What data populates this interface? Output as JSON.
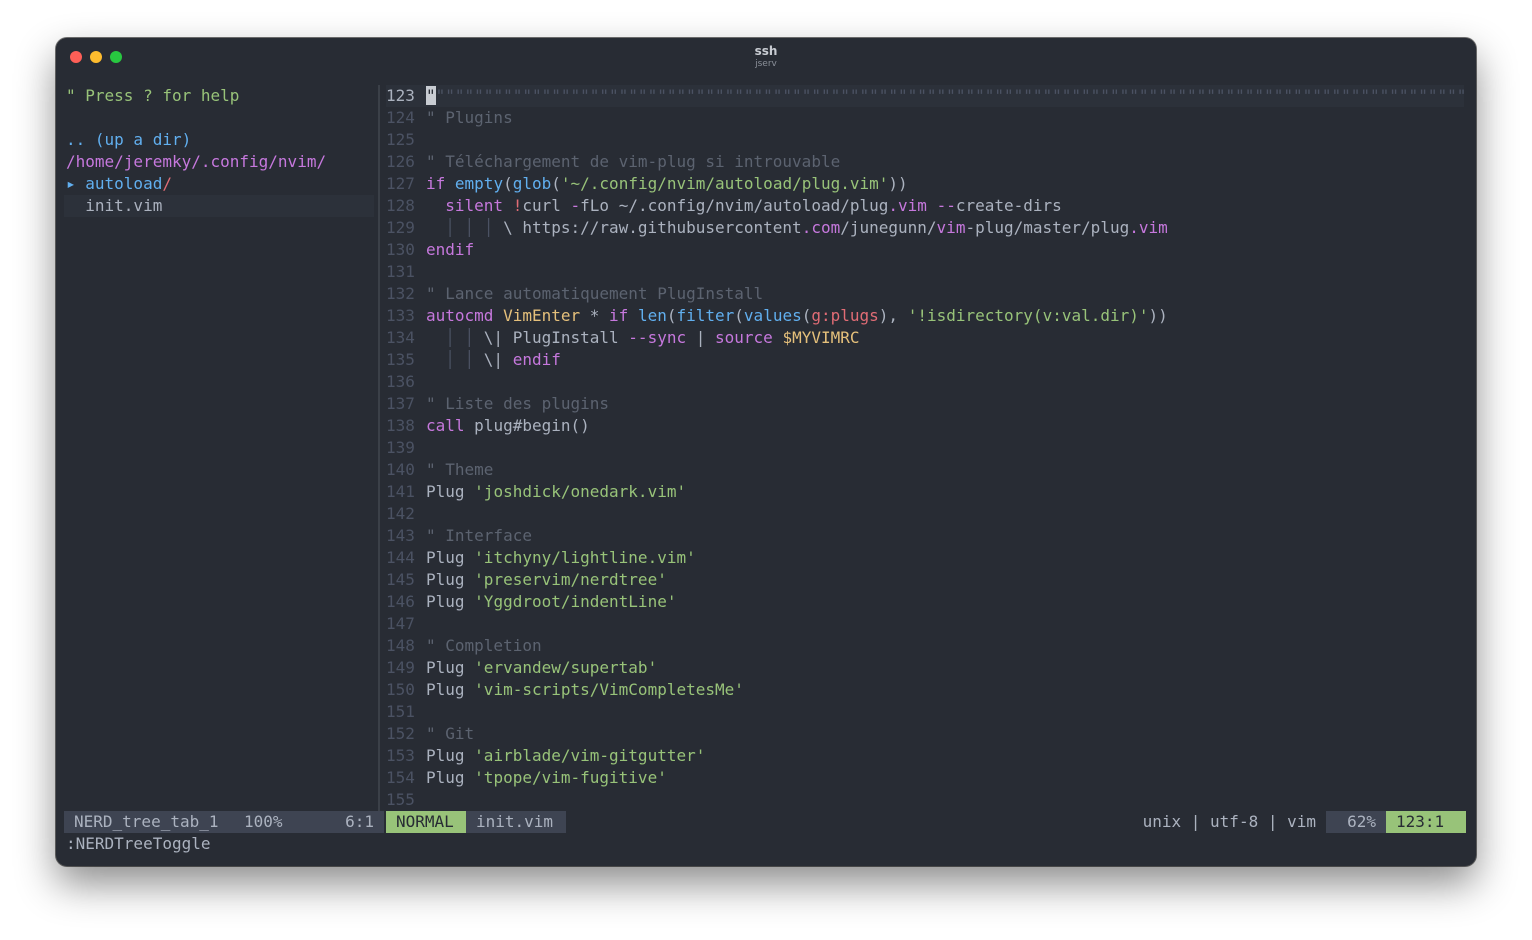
{
  "window": {
    "title": "ssh",
    "subtitle": "jserv"
  },
  "nerdtree": {
    "help": "\" Press ? for help",
    "up_dir": ".. (up a dir)",
    "root_path": "/home/jeremky/.config/nvim/",
    "dir_arrow": "▸ ",
    "dir_name": "autoload",
    "dir_slash": "/",
    "file_name": "init.vim"
  },
  "editor": {
    "lines": [
      {
        "n": "123",
        "tokens": [
          [
            "cursor",
            "\""
          ],
          [
            "c-dim",
            "\"\"\"\"\"\"\"\"\"\"\"\"\"\"\"\"\"\"\"\"\"\"\"\"\"\"\"\"\"\"\"\"\"\"\"\"\"\"\"\"\"\"\"\"\"\"\"\"\"\"\"\"\"\"\"\"\"\"\"\"\"\"\"\"\"\"\"\"\"\"\"\"\"\"\"\"\"\"\"\"\"\"\"\"\"\"\"\"\"\"\"\"\"\"\"\"\"\"\"\"\"\"\"\"\"\"\"\"\"\"\"\"\"\"\"\"\"\"\"\"\"\"\"\"\"\"\"\"\"\"\"\"\"\"\"\""
          ]
        ]
      },
      {
        "n": "124",
        "tokens": [
          [
            "c-cmt",
            "\" Plugins"
          ]
        ]
      },
      {
        "n": "125",
        "tokens": []
      },
      {
        "n": "126",
        "tokens": [
          [
            "c-cmt",
            "\" Téléchargement de vim-plug si introuvable"
          ]
        ]
      },
      {
        "n": "127",
        "tokens": [
          [
            "c-kw",
            "if "
          ],
          [
            "c-fn",
            "empty"
          ],
          [
            "c-pl",
            "("
          ],
          [
            "c-fn",
            "glob"
          ],
          [
            "c-pl",
            "("
          ],
          [
            "c-str",
            "'~/.config/nvim/autoload/plug.vim'"
          ],
          [
            "c-pl",
            "))"
          ]
        ]
      },
      {
        "n": "128",
        "tokens": [
          [
            "c-pl",
            "  "
          ],
          [
            "c-kw",
            "silent "
          ],
          [
            "c-red",
            "!"
          ],
          [
            "c-pl",
            "curl "
          ],
          [
            "c-kw",
            "-"
          ],
          [
            "c-pl",
            "fLo ~/.config/nvim/autoload/plug"
          ],
          [
            "c-kw",
            ".vim "
          ],
          [
            "c-kw",
            "--"
          ],
          [
            "c-pl",
            "create-dirs"
          ]
        ]
      },
      {
        "n": "129",
        "tokens": [
          [
            "c-dim",
            "  │ │ │ "
          ],
          [
            "c-pl",
            "\\ https://raw.githubusercontent"
          ],
          [
            "c-kw",
            ".com"
          ],
          [
            "c-pl",
            "/junegunn/"
          ],
          [
            "c-kw",
            "vim"
          ],
          [
            "c-pl",
            "-plug/master/plug"
          ],
          [
            "c-kw",
            ".vim"
          ]
        ]
      },
      {
        "n": "130",
        "tokens": [
          [
            "c-kw",
            "endif"
          ]
        ]
      },
      {
        "n": "131",
        "tokens": []
      },
      {
        "n": "132",
        "tokens": [
          [
            "c-cmt",
            "\" Lance automatiquement PlugInstall"
          ]
        ]
      },
      {
        "n": "133",
        "tokens": [
          [
            "c-kw",
            "autocmd "
          ],
          [
            "c-yel",
            "VimEnter "
          ],
          [
            "c-pl",
            "* "
          ],
          [
            "c-kw",
            "if "
          ],
          [
            "c-fn",
            "len"
          ],
          [
            "c-pl",
            "("
          ],
          [
            "c-fn",
            "filter"
          ],
          [
            "c-pl",
            "("
          ],
          [
            "c-fn",
            "values"
          ],
          [
            "c-pl",
            "("
          ],
          [
            "c-red",
            "g:plugs"
          ],
          [
            "c-pl",
            "), "
          ],
          [
            "c-str",
            "'!isdirectory(v:val.dir)'"
          ],
          [
            "c-pl",
            "))"
          ]
        ]
      },
      {
        "n": "134",
        "tokens": [
          [
            "c-dim",
            "  │ │ "
          ],
          [
            "c-pl",
            "\\| PlugInstall "
          ],
          [
            "c-kw",
            "--sync "
          ],
          [
            "c-pl",
            "| "
          ],
          [
            "c-kw",
            "source "
          ],
          [
            "c-yel",
            "$MYVIMRC"
          ]
        ]
      },
      {
        "n": "135",
        "tokens": [
          [
            "c-dim",
            "  │ │ "
          ],
          [
            "c-pl",
            "\\| "
          ],
          [
            "c-kw",
            "endif"
          ]
        ]
      },
      {
        "n": "136",
        "tokens": []
      },
      {
        "n": "137",
        "tokens": [
          [
            "c-cmt",
            "\" Liste des plugins"
          ]
        ]
      },
      {
        "n": "138",
        "tokens": [
          [
            "c-kw",
            "call "
          ],
          [
            "c-pl",
            "plug#begin()"
          ]
        ]
      },
      {
        "n": "139",
        "tokens": []
      },
      {
        "n": "140",
        "tokens": [
          [
            "c-cmt",
            "\" Theme"
          ]
        ]
      },
      {
        "n": "141",
        "tokens": [
          [
            "c-pl",
            "Plug "
          ],
          [
            "c-str",
            "'joshdick/onedark.vim'"
          ]
        ]
      },
      {
        "n": "142",
        "tokens": []
      },
      {
        "n": "143",
        "tokens": [
          [
            "c-cmt",
            "\" Interface"
          ]
        ]
      },
      {
        "n": "144",
        "tokens": [
          [
            "c-pl",
            "Plug "
          ],
          [
            "c-str",
            "'itchyny/lightline.vim'"
          ]
        ]
      },
      {
        "n": "145",
        "tokens": [
          [
            "c-pl",
            "Plug "
          ],
          [
            "c-str",
            "'preservim/nerdtree'"
          ]
        ]
      },
      {
        "n": "146",
        "tokens": [
          [
            "c-pl",
            "Plug "
          ],
          [
            "c-str",
            "'Yggdroot/indentLine'"
          ]
        ]
      },
      {
        "n": "147",
        "tokens": []
      },
      {
        "n": "148",
        "tokens": [
          [
            "c-cmt",
            "\" Completion"
          ]
        ]
      },
      {
        "n": "149",
        "tokens": [
          [
            "c-pl",
            "Plug "
          ],
          [
            "c-str",
            "'ervandew/supertab'"
          ]
        ]
      },
      {
        "n": "150",
        "tokens": [
          [
            "c-pl",
            "Plug "
          ],
          [
            "c-str",
            "'vim-scripts/VimCompletesMe'"
          ]
        ]
      },
      {
        "n": "151",
        "tokens": []
      },
      {
        "n": "152",
        "tokens": [
          [
            "c-cmt",
            "\" Git"
          ]
        ]
      },
      {
        "n": "153",
        "tokens": [
          [
            "c-pl",
            "Plug "
          ],
          [
            "c-str",
            "'airblade/vim-gitgutter'"
          ]
        ]
      },
      {
        "n": "154",
        "tokens": [
          [
            "c-pl",
            "Plug "
          ],
          [
            "c-str",
            "'tpope/vim-fugitive'"
          ]
        ]
      },
      {
        "n": "155",
        "tokens": []
      }
    ]
  },
  "statusline": {
    "tree_name": "NERD_tree_tab_1",
    "tree_percent": "100%",
    "tree_pos": "6:1",
    "mode": "NORMAL",
    "filename": "init.vim",
    "fileinfo": "unix | utf-8 | vim",
    "percent": "62%",
    "position": "123:1"
  },
  "command_line": ":NERDTreeToggle",
  "colors": {
    "background": "#282c34",
    "mode_green": "#98c379",
    "status_gray": "#3e4452",
    "keyword": "#c678dd",
    "function": "#61afef",
    "string": "#98c379",
    "comment": "#5c6370"
  }
}
